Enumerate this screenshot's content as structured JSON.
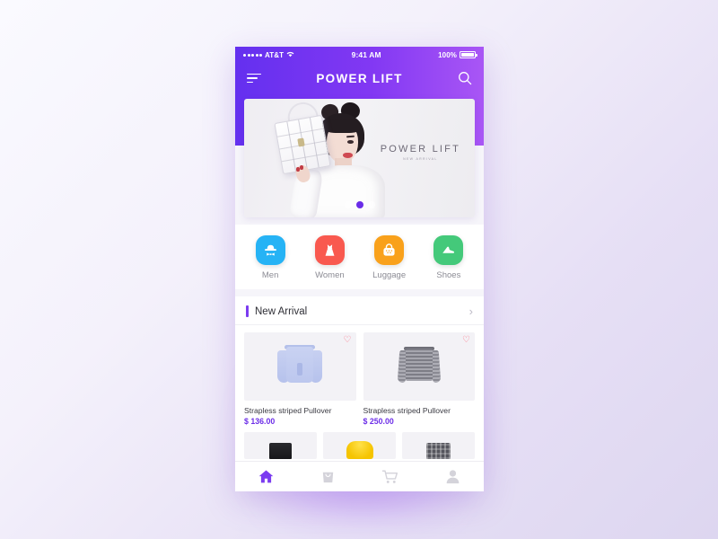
{
  "status_bar": {
    "carrier": "AT&T",
    "signal_icon": "signal-dots-icon",
    "wifi_icon": "wifi-icon",
    "time": "9:41 AM",
    "battery_percent": "100%",
    "battery_icon": "battery-full-icon"
  },
  "header": {
    "menu_icon": "hamburger-menu-icon",
    "title": "POWER LIFT",
    "search_icon": "search-icon"
  },
  "hero": {
    "brand_title": "POWER LIFT",
    "brand_subtitle": "NEW ARRIVAL",
    "pagination_dots": 3,
    "active_dot_index": 1,
    "active_dot_color": "#6a2ce8",
    "alt": "model holding white handbag"
  },
  "categories": [
    {
      "label": "Men",
      "icon": "hat-bowtie-icon",
      "color": "#26b3f5"
    },
    {
      "label": "Women",
      "icon": "dress-icon",
      "color": "#f9594f"
    },
    {
      "label": "Luggage",
      "icon": "handbag-icon",
      "color": "#f9a11b"
    },
    {
      "label": "Shoes",
      "icon": "shoe-icon",
      "color": "#44c97a"
    }
  ],
  "new_arrival": {
    "title": "New Arrival",
    "accent_color": "#7b3cf0",
    "more_icon": "chevron-right-icon",
    "products": [
      {
        "name": "Strapless striped Pullover",
        "price": "$ 136.00",
        "favorite_icon": "heart-outline-icon",
        "image_alt": "light blue strapless striped pullover"
      },
      {
        "name": "Strapless striped Pullover",
        "price": "$ 250.00",
        "favorite_icon": "heart-outline-icon",
        "image_alt": "gray strapless striped pullover"
      }
    ],
    "products_partial": [
      {
        "image_alt": "black mini skirt"
      },
      {
        "image_alt": "yellow jacket"
      },
      {
        "image_alt": "gray plaid skirt"
      }
    ]
  },
  "tab_bar": {
    "active_color": "#7b3cf0",
    "inactive_color": "#d4d3da",
    "tabs": [
      {
        "name": "home",
        "icon": "home-icon",
        "active": true
      },
      {
        "name": "bag",
        "icon": "shopping-bag-icon",
        "active": false
      },
      {
        "name": "cart",
        "icon": "shopping-cart-icon",
        "active": false
      },
      {
        "name": "profile",
        "icon": "person-icon",
        "active": false
      }
    ]
  }
}
